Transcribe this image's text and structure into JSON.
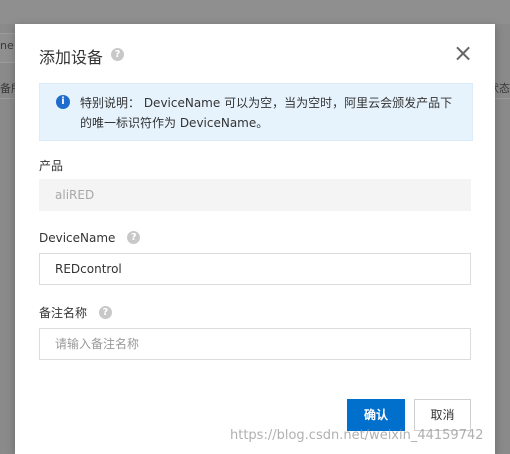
{
  "background": {
    "field_fragment": "ne",
    "left_fragment": "备所",
    "right_fragment": "状态"
  },
  "dialog": {
    "title": "添加设备",
    "close_symbol": "×",
    "notice_text": "特别说明： DeviceName 可以为空，当为空时，阿里云会颁发产品下的唯一标识符作为 DeviceName。"
  },
  "form": {
    "product_label": "产品",
    "product_value": "aliRED",
    "device_name_label": "DeviceName",
    "device_name_value": "REDcontrol",
    "remark_label": "备注名称",
    "remark_placeholder": "请输入备注名称"
  },
  "actions": {
    "confirm_label": "确认",
    "cancel_label": "取消"
  },
  "watermark": "https://blog.csdn.net/weixin_44159742",
  "colors": {
    "primary": "#0070cc",
    "notice_bg": "#e6f3fd",
    "info_icon": "#1e6dcc"
  },
  "icons": {
    "help": "question-circle-icon",
    "close": "close-icon",
    "info": "info-circle-icon"
  }
}
